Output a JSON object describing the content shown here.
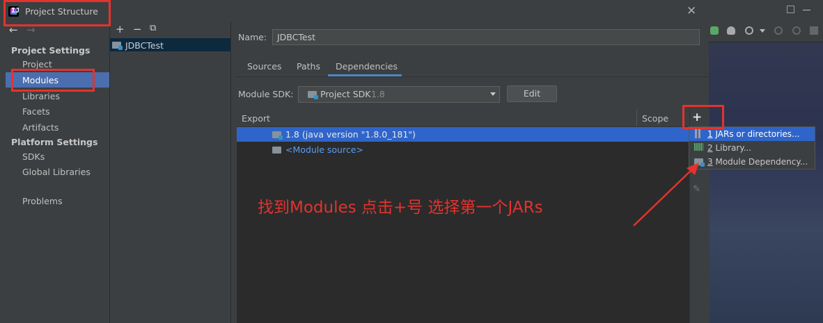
{
  "window": {
    "title": "Project Structure",
    "close_label": "✕"
  },
  "nav": {
    "back": "←",
    "forward": "→"
  },
  "sidebar": {
    "project_settings_header": "Project Settings",
    "project_settings": [
      "Project",
      "Modules",
      "Libraries",
      "Facets",
      "Artifacts"
    ],
    "platform_settings_header": "Platform Settings",
    "platform_settings": [
      "SDKs",
      "Global Libraries"
    ],
    "problems": "Problems",
    "selected": "Modules"
  },
  "modules_toolbar": {
    "add": "+",
    "remove": "−",
    "copy": "⧉"
  },
  "modules": [
    {
      "name": "JDBCTest"
    }
  ],
  "module_detail": {
    "name_label": "Name:",
    "name_value": "JDBCTest",
    "tabs": [
      "Sources",
      "Paths",
      "Dependencies"
    ],
    "active_tab": "Dependencies",
    "sdk_label": "Module SDK:",
    "sdk_value": "Project SDK",
    "sdk_version": "1.8",
    "edit_label": "Edit"
  },
  "dependencies": {
    "columns": {
      "export": "Export",
      "scope": "Scope"
    },
    "add": "+",
    "rows": [
      {
        "label": "1.8 (java version \"1.8.0_181\")",
        "selected": true
      },
      {
        "label": "<Module source>",
        "selected": false
      }
    ]
  },
  "add_menu": {
    "items": [
      {
        "number": "1",
        "label": "JARs or directories...",
        "selected": true
      },
      {
        "number": "2",
        "label": "Library...",
        "selected": false
      },
      {
        "number": "3",
        "label": "Module Dependency...",
        "selected": false
      }
    ]
  },
  "annotation": {
    "text": "找到Modules 点击+号 选择第一个JARs",
    "color": "#e5322d"
  },
  "colors": {
    "selection": "#4b6eaf",
    "row_selection": "#2f65ca",
    "background": "#3c3f41",
    "table_bg": "#2b2b2b",
    "link": "#589df6"
  }
}
